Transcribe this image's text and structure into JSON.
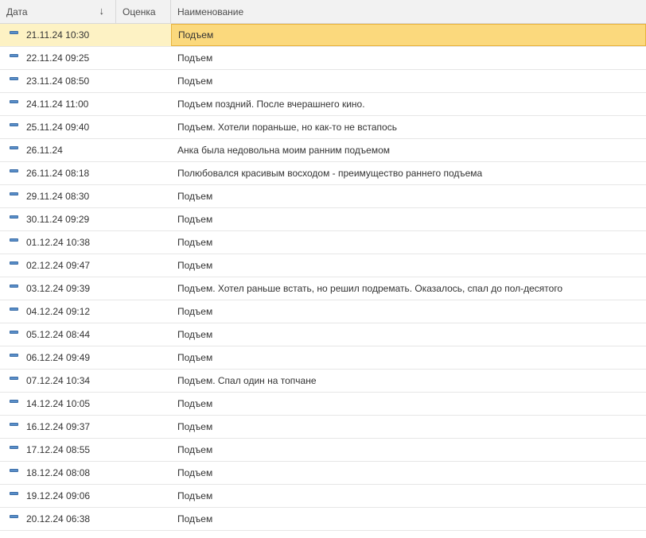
{
  "header": {
    "date": "Дата",
    "score": "Оценка",
    "name": "Наименование",
    "sort_indicator": "↓"
  },
  "icons": {
    "row_icon": "document-item-icon",
    "row_icon_color": "#5a8fc9",
    "selection_color": "#fbd97d"
  },
  "rows": [
    {
      "date": "21.11.24 10:30",
      "score": "",
      "name": "Подъем",
      "selected": true
    },
    {
      "date": "22.11.24 09:25",
      "score": "",
      "name": "Подъем"
    },
    {
      "date": "23.11.24 08:50",
      "score": "",
      "name": "Подъем"
    },
    {
      "date": "24.11.24 11:00",
      "score": "",
      "name": "Подъем поздний. После вчерашнего кино."
    },
    {
      "date": "25.11.24 09:40",
      "score": "",
      "name": "Подъем. Хотели пораньше, но как-то не встапось"
    },
    {
      "date": "26.11.24",
      "score": "",
      "name": "Анка была недовольна моим ранним подъемом"
    },
    {
      "date": "26.11.24 08:18",
      "score": "",
      "name": "Полюбовался красивым восходом - преимущество раннего подъема"
    },
    {
      "date": "29.11.24 08:30",
      "score": "",
      "name": "Подъем"
    },
    {
      "date": "30.11.24 09:29",
      "score": "",
      "name": "Подъем"
    },
    {
      "date": "01.12.24 10:38",
      "score": "",
      "name": "Подъем"
    },
    {
      "date": "02.12.24 09:47",
      "score": "",
      "name": "Подъем"
    },
    {
      "date": "03.12.24 09:39",
      "score": "",
      "name": "Подъем. Хотел раньше встать, но решил подремать. Оказалось, спал до пол-десятого"
    },
    {
      "date": "04.12.24 09:12",
      "score": "",
      "name": "Подъем"
    },
    {
      "date": "05.12.24 08:44",
      "score": "",
      "name": "Подъем"
    },
    {
      "date": "06.12.24 09:49",
      "score": "",
      "name": "Подъем"
    },
    {
      "date": "07.12.24 10:34",
      "score": "",
      "name": "Подъем. Спал один на топчане"
    },
    {
      "date": "14.12.24 10:05",
      "score": "",
      "name": "Подъем"
    },
    {
      "date": "16.12.24 09:37",
      "score": "",
      "name": "Подъем"
    },
    {
      "date": "17.12.24 08:55",
      "score": "",
      "name": "Подъем"
    },
    {
      "date": "18.12.24 08:08",
      "score": "",
      "name": "Подъем"
    },
    {
      "date": "19.12.24 09:06",
      "score": "",
      "name": "Подъем"
    },
    {
      "date": "20.12.24 06:38",
      "score": "",
      "name": "Подъем"
    }
  ]
}
